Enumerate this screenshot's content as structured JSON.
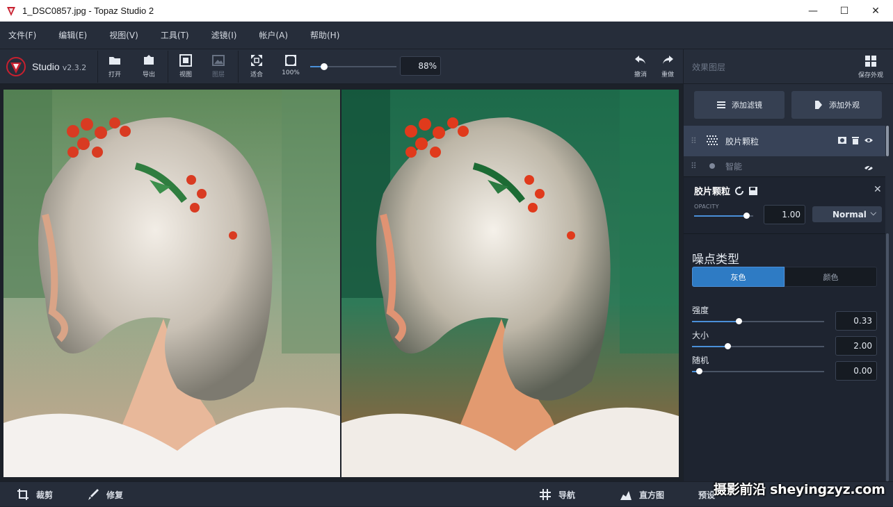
{
  "window": {
    "title": "1_DSC0857.jpg - Topaz Studio 2",
    "minimize": "—",
    "maximize": "☐",
    "close": "✕"
  },
  "menu": [
    "文件(F)",
    "编辑(E)",
    "视图(V)",
    "工具(T)",
    "滤镜(I)",
    "帐户(A)",
    "帮助(H)"
  ],
  "toolbar": {
    "brand_name": "Studio",
    "version": "v2.3.2",
    "open": "打开",
    "export": "导出",
    "view": "视图",
    "compare": "图层",
    "fit": "适合",
    "zoom100": "100%",
    "zoom_value": "88%",
    "zoom_fraction": 0.15,
    "undo": "撤消",
    "redo": "重做"
  },
  "panel": {
    "header": "效果图层",
    "save_look": "保存外观",
    "add_filter": "添加滤镜",
    "add_look": "添加外观",
    "layers": [
      {
        "name": "胶片颗粒",
        "active": true
      },
      {
        "name": "智能",
        "active": false
      }
    ]
  },
  "filter": {
    "title": "胶片颗粒",
    "close": "✕",
    "opacity_label": "OPACITY",
    "opacity_value": "1.00",
    "opacity_fraction": 0.88,
    "blend_mode": "Normal",
    "noise_type_title": "噪点类型",
    "noise_gray": "灰色",
    "noise_color": "颜色",
    "params": [
      {
        "label": "强度",
        "value": "0.33",
        "fraction": 0.35
      },
      {
        "label": "大小",
        "value": "2.00",
        "fraction": 0.27
      },
      {
        "label": "随机",
        "value": "0.00",
        "fraction": 0.05
      }
    ]
  },
  "bottom": {
    "crop": "裁剪",
    "repair": "修复",
    "navigator": "导航",
    "histogram": "直方图",
    "preset": "预设"
  },
  "watermark": "摄影前沿 sheyingzyz.com",
  "colors": {
    "accent": "#2e7bc4",
    "panel_bg": "#262d3a",
    "canvas_bg": "#1c2129"
  }
}
